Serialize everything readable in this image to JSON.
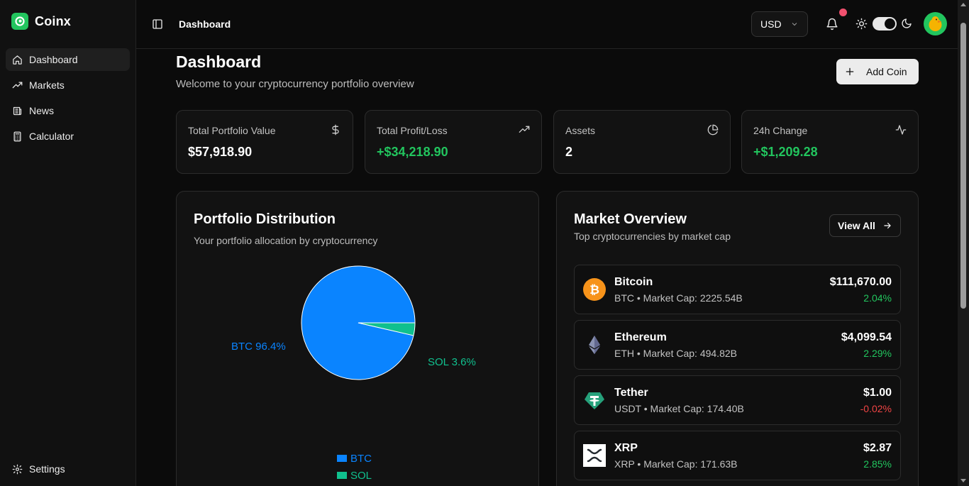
{
  "app": {
    "name": "Coinx",
    "brand_color": "#22c55e"
  },
  "sidebar": {
    "items": [
      {
        "label": "Dashboard",
        "icon": "home-icon",
        "active": true
      },
      {
        "label": "Markets",
        "icon": "trending-up-icon"
      },
      {
        "label": "News",
        "icon": "newspaper-icon"
      },
      {
        "label": "Calculator",
        "icon": "calculator-icon"
      }
    ],
    "settings_label": "Settings"
  },
  "header": {
    "title": "Dashboard",
    "currency": "USD",
    "notification_dot_color": "#f0506e"
  },
  "main": {
    "title": "Dashboard",
    "subtitle": "Welcome to your cryptocurrency portfolio overview",
    "add_coin_label": "Add Coin"
  },
  "stats": [
    {
      "label": "Total Portfolio Value",
      "value": "$57,918.90",
      "icon": "dollar-icon",
      "positive": false
    },
    {
      "label": "Total Profit/Loss",
      "value": "+$34,218.90",
      "icon": "trending-up-icon",
      "positive": true
    },
    {
      "label": "Assets",
      "value": "2",
      "icon": "pie-chart-icon",
      "positive": false
    },
    {
      "label": "24h Change",
      "value": "+$1,209.28",
      "icon": "activity-icon",
      "positive": true
    }
  ],
  "distribution": {
    "title": "Portfolio Distribution",
    "subtitle": "Your portfolio allocation by cryptocurrency"
  },
  "chart_data": {
    "type": "pie",
    "categories": [
      "BTC",
      "SOL"
    ],
    "values": [
      96.4,
      3.6
    ],
    "slice_labels": [
      "BTC 96.4%",
      "SOL 3.6%"
    ],
    "colors": [
      "#0a84ff",
      "#10c08e"
    ],
    "legend": [
      "BTC",
      "SOL"
    ],
    "legend_position": "bottom"
  },
  "market": {
    "title": "Market Overview",
    "subtitle": "Top cryptocurrencies by market cap",
    "view_all_label": "View All",
    "coins": [
      {
        "name": "Bitcoin",
        "meta": "BTC • Market Cap: 2225.54B",
        "price": "$111,670.00",
        "change": "2.04%",
        "positive": true,
        "icon": "bitcoin-icon"
      },
      {
        "name": "Ethereum",
        "meta": "ETH • Market Cap: 494.82B",
        "price": "$4,099.54",
        "change": "2.29%",
        "positive": true,
        "icon": "ethereum-icon"
      },
      {
        "name": "Tether",
        "meta": "USDT • Market Cap: 174.40B",
        "price": "$1.00",
        "change": "-0.02%",
        "positive": false,
        "icon": "tether-icon"
      },
      {
        "name": "XRP",
        "meta": "XRP • Market Cap: 171.63B",
        "price": "$2.87",
        "change": "2.85%",
        "positive": true,
        "icon": "xrp-icon"
      }
    ],
    "positive_color": "#22c55e",
    "negative_color": "#ef4444"
  }
}
